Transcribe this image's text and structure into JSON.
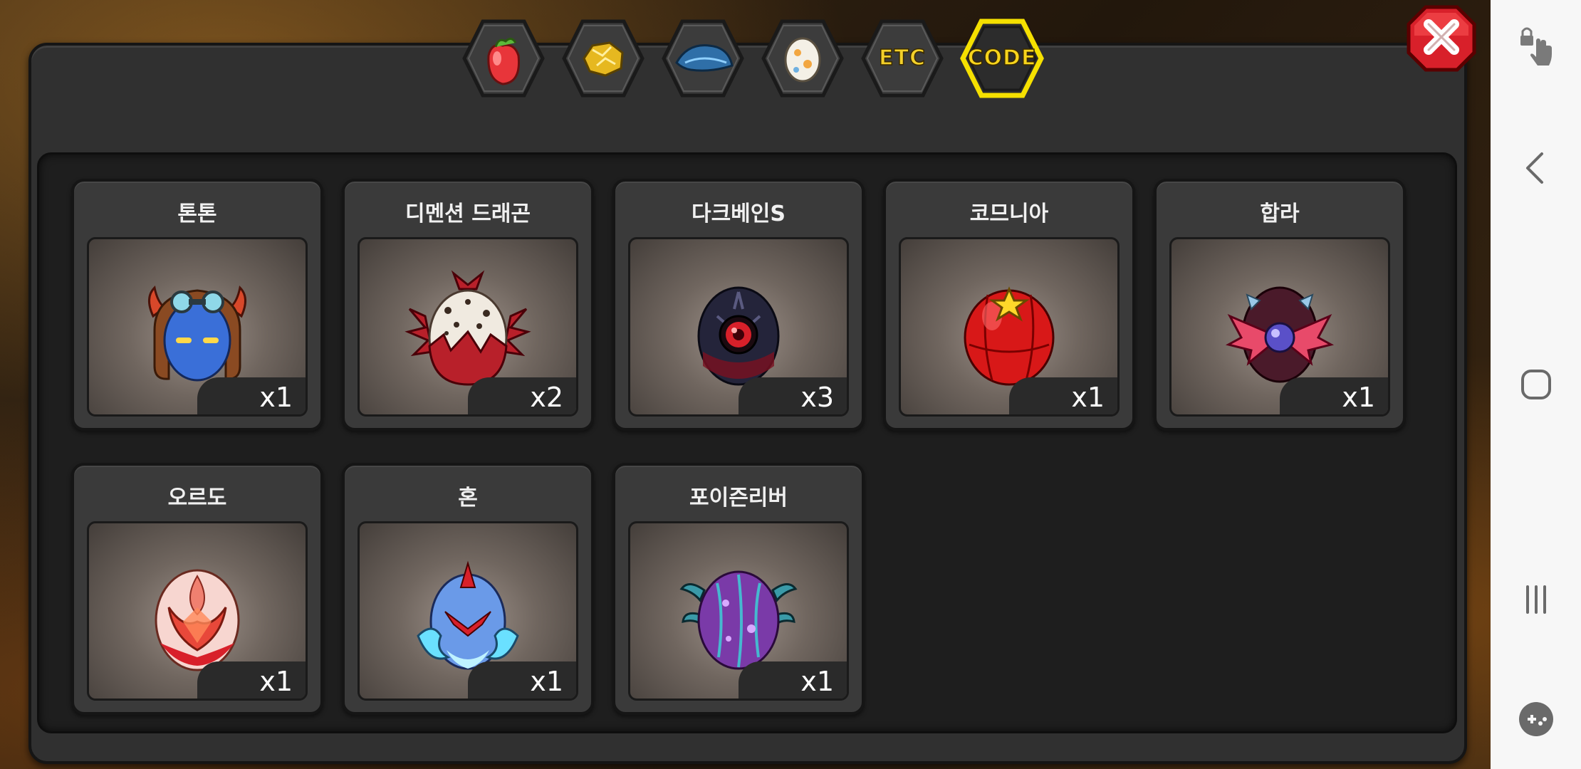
{
  "tabs": [
    {
      "id": "fruit",
      "label": "",
      "icon": "fruit-icon",
      "active": false
    },
    {
      "id": "gold",
      "label": "",
      "icon": "gold-ore-icon",
      "active": false
    },
    {
      "id": "feather",
      "label": "",
      "icon": "feather-icon",
      "active": false
    },
    {
      "id": "egg",
      "label": "",
      "icon": "egg-icon",
      "active": false
    },
    {
      "id": "etc",
      "label": "ETC",
      "icon": "",
      "active": false
    },
    {
      "id": "code",
      "label": "CODE",
      "icon": "",
      "active": true
    }
  ],
  "close_icon": "close-icon",
  "items": [
    {
      "name": "톤톤",
      "count": "x1",
      "egg": "aviator-egg"
    },
    {
      "name": "디멘션 드래곤",
      "count": "x2",
      "egg": "spotted-dragon-egg"
    },
    {
      "name": "다크베인S",
      "count": "x3",
      "egg": "dark-eye-egg"
    },
    {
      "name": "코므니아",
      "count": "x1",
      "egg": "red-star-egg"
    },
    {
      "name": "합라",
      "count": "x1",
      "egg": "winged-orb-egg"
    },
    {
      "name": "오르도",
      "count": "x1",
      "egg": "flame-egg"
    },
    {
      "name": "혼",
      "count": "x1",
      "egg": "blue-spirit-egg"
    },
    {
      "name": "포이즌리버",
      "count": "x1",
      "egg": "poison-egg"
    }
  ],
  "system_nav": [
    "touch-lock-icon",
    "back-icon",
    "home-icon",
    "recents-icon",
    "game-tools-icon"
  ],
  "colors": {
    "tab_active_border": "#f5e000",
    "panel": "#303030",
    "inner": "#1e1e1e",
    "close_red": "#d8202a"
  }
}
